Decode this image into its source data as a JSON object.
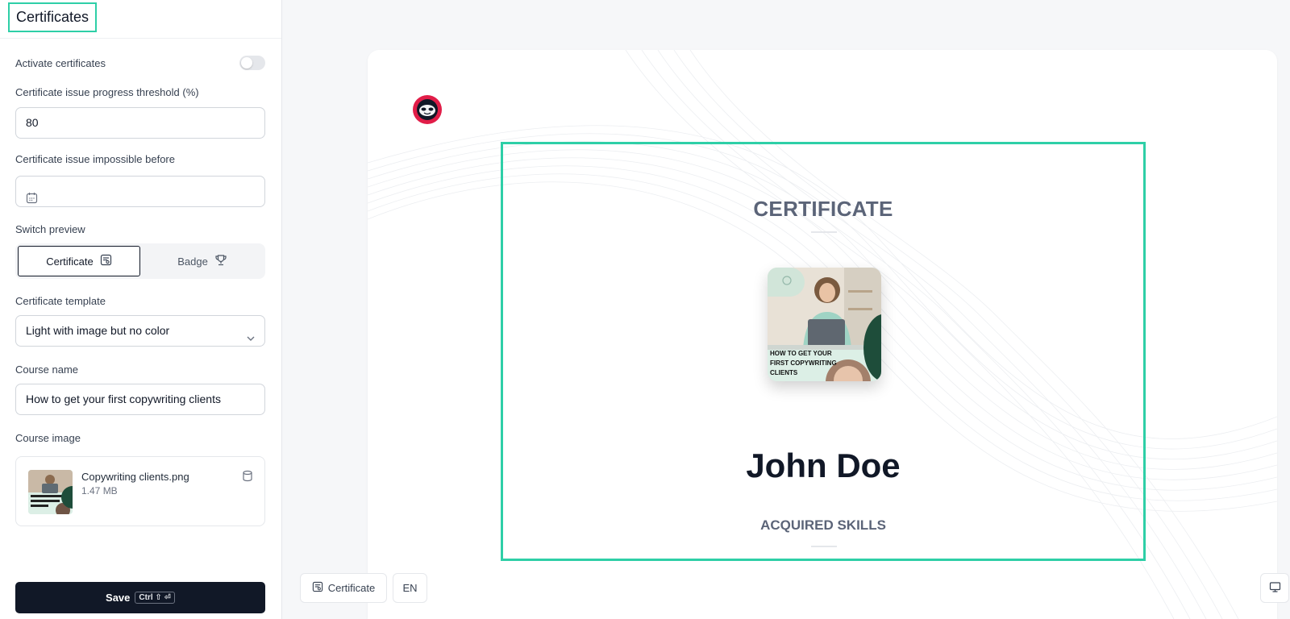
{
  "sidebar": {
    "title": "Certificates",
    "activate_label": "Activate certificates",
    "threshold_label": "Certificate issue progress threshold (%)",
    "threshold_value": "80",
    "impossible_before_label": "Certificate issue impossible before",
    "impossible_before_value": "",
    "switch_preview_label": "Switch preview",
    "switch_options": [
      "Certificate",
      "Badge"
    ],
    "template_label": "Certificate template",
    "template_value": "Light with image but no color",
    "course_name_label": "Course name",
    "course_name_value": "How to get your first copywriting clients",
    "course_image_label": "Course image",
    "file_name": "Copywriting clients.png",
    "file_size": "1.47 MB",
    "save_label": "Save",
    "save_shortcut": "Ctrl ⇧ ⏎"
  },
  "preview": {
    "cert_title": "CERTIFICATE",
    "course_image_text": "HOW TO GET YOUR FIRST COPYWRITING CLIENTS",
    "recipient": "John Doe",
    "skills_title": "ACQUIRED SKILLS",
    "mode_button": "Certificate",
    "lang_button": "EN"
  },
  "colors": {
    "accent": "#2ecfa7",
    "dark": "#111827",
    "logo": "#e11d48"
  },
  "toggles": {
    "activate_certificates": false
  }
}
